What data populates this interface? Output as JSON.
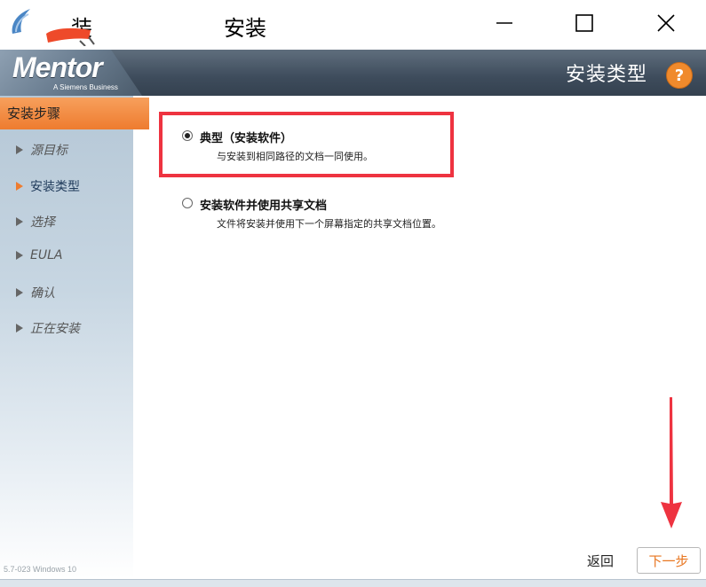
{
  "window": {
    "title": "安装",
    "title_fragment": "装",
    "controls": {
      "minimize": "—",
      "maximize": "☐",
      "close": "✕"
    }
  },
  "header": {
    "logo_text": "Mentor",
    "logo_subtitle": "A Siemens Business",
    "page_title": "安装类型",
    "help_label": "?"
  },
  "sidebar": {
    "header": "安装步骤",
    "items": [
      {
        "label": "源目标",
        "active": false
      },
      {
        "label": "安装类型",
        "active": true
      },
      {
        "label": "选择",
        "active": false
      },
      {
        "label": "EULA",
        "active": false
      },
      {
        "label": "确认",
        "active": false
      },
      {
        "label": "正在安装",
        "active": false
      }
    ]
  },
  "options": [
    {
      "label": "典型（安装软件）",
      "description": "与安装到相同路径的文档一同使用。",
      "selected": true
    },
    {
      "label": "安装软件并使用共享文档",
      "description": "文件将安装并使用下一个屏幕指定的共享文档位置。",
      "selected": false
    }
  ],
  "footer": {
    "version": "5.7-023  Windows 10",
    "back_label": "返回",
    "next_label": "下一步"
  },
  "colors": {
    "accent_orange": "#ee7c2f",
    "highlight_red": "#ee3340",
    "banner_dark": "#3e4c5c"
  }
}
